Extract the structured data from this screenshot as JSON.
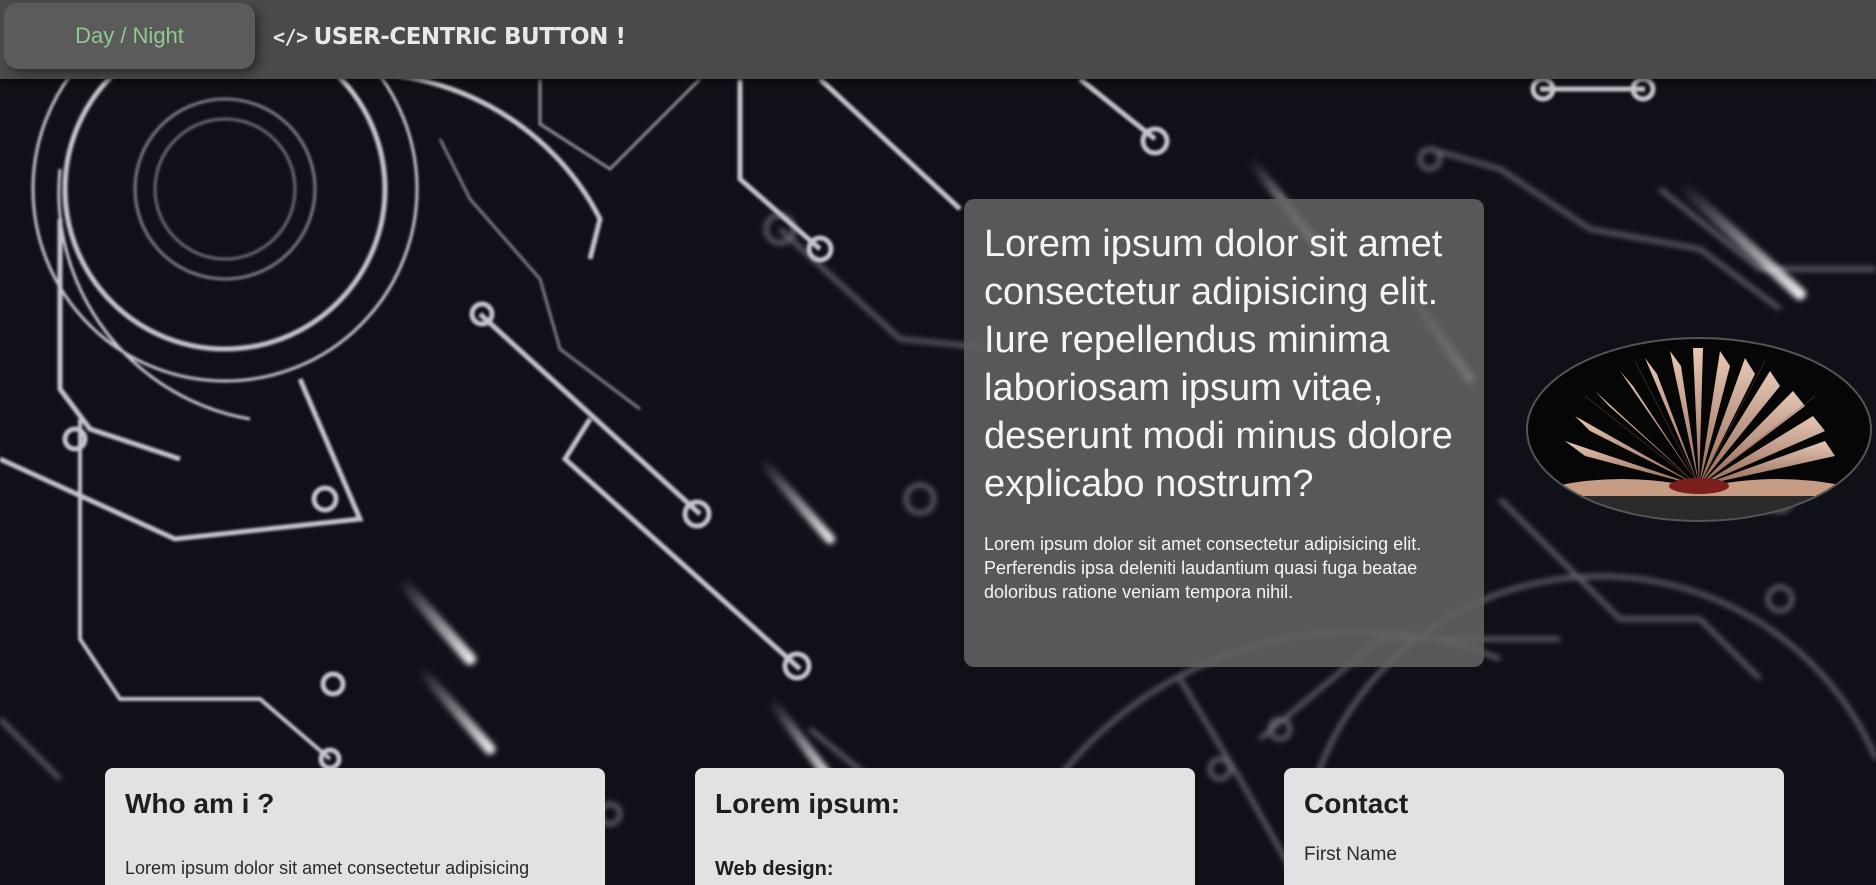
{
  "header": {
    "toggle_label": "Day / Night",
    "brand_icon": "</>",
    "brand_text": "USER-CENTRIC BUTTON !"
  },
  "hero": {
    "title": "Lorem ipsum dolor sit amet consectetur adipisicing elit. Iure repellendus minima laboriosam ipsum vitae, deserunt modi minus dolore explicabo nostrum?",
    "text": "Lorem ipsum dolor sit amet consectetur adipisicing elit. Perferendis ipsa deleniti laudantium quasi fuga beatae doloribus ratione veniam tempora nihil."
  },
  "cards": {
    "about": {
      "title": "Who am i ?",
      "text": "Lorem ipsum dolor sit amet consectetur adipisicing"
    },
    "services": {
      "title": "Lorem ipsum:",
      "subtitle": "Web design:"
    },
    "contact": {
      "title": "Contact",
      "field_label": "First Name"
    }
  },
  "icons": {
    "brand": "code-icon",
    "book": "open-book-image"
  },
  "colors": {
    "topbar": "#4a4a4a",
    "toggle_text": "#8fc98f",
    "background": "#0d0d14",
    "hero_card": "#626262",
    "card": "#e2e2e2"
  }
}
